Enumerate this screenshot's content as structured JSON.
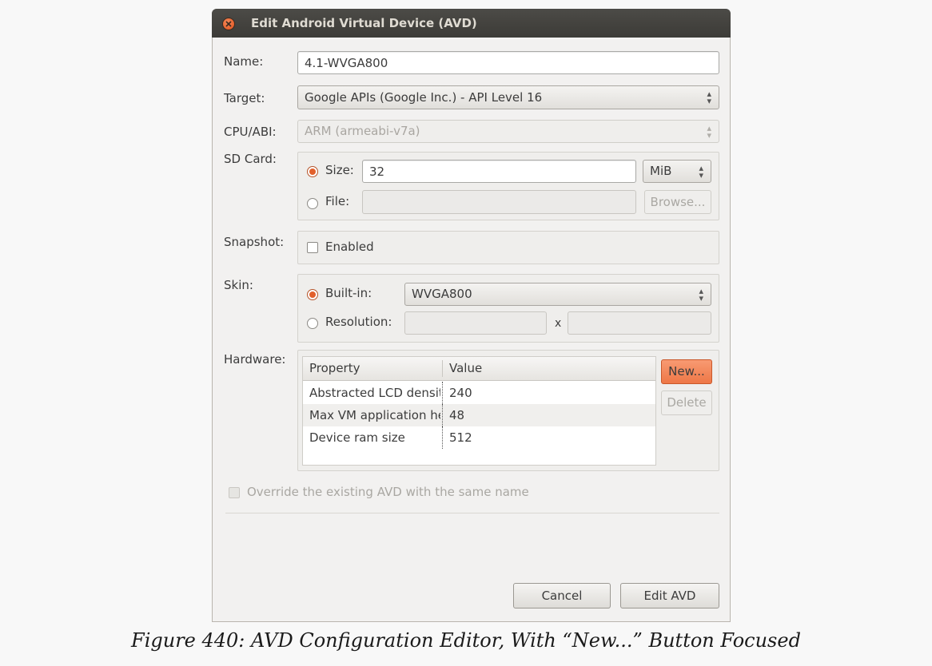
{
  "window": {
    "title": "Edit Android Virtual Device (AVD)"
  },
  "labels": {
    "name": "Name:",
    "target": "Target:",
    "cpu": "CPU/ABI:",
    "sdcard": "SD Card:",
    "snapshot": "Snapshot:",
    "skin": "Skin:",
    "hardware": "Hardware:"
  },
  "fields": {
    "name_value": "4.1-WVGA800",
    "target_value": "Google APIs (Google Inc.) - API Level 16",
    "cpu_value": "ARM (armeabi-v7a)"
  },
  "sdcard": {
    "size_label": "Size:",
    "size_value": "32",
    "unit": "MiB",
    "file_label": "File:",
    "file_value": "",
    "browse_label": "Browse..."
  },
  "snapshot": {
    "enabled_label": "Enabled"
  },
  "skin": {
    "builtin_label": "Built-in:",
    "builtin_value": "WVGA800",
    "resolution_label": "Resolution:",
    "x_label": "x"
  },
  "hardware": {
    "columns": [
      "Property",
      "Value"
    ],
    "rows": [
      {
        "property": "Abstracted LCD density",
        "value": "240"
      },
      {
        "property": "Max VM application heap size",
        "value": "48"
      },
      {
        "property": "Device ram size",
        "value": "512"
      }
    ],
    "new_label": "New...",
    "delete_label": "Delete"
  },
  "override_label": "Override the existing AVD with the same name",
  "buttons": {
    "cancel": "Cancel",
    "edit": "Edit AVD"
  },
  "caption": "Figure 440: AVD Configuration Editor, With “New...” Button Focused",
  "colors": {
    "accent": "#ee7747",
    "titlebar": "#3c3b37",
    "dialog_bg": "#f2f1f0"
  }
}
